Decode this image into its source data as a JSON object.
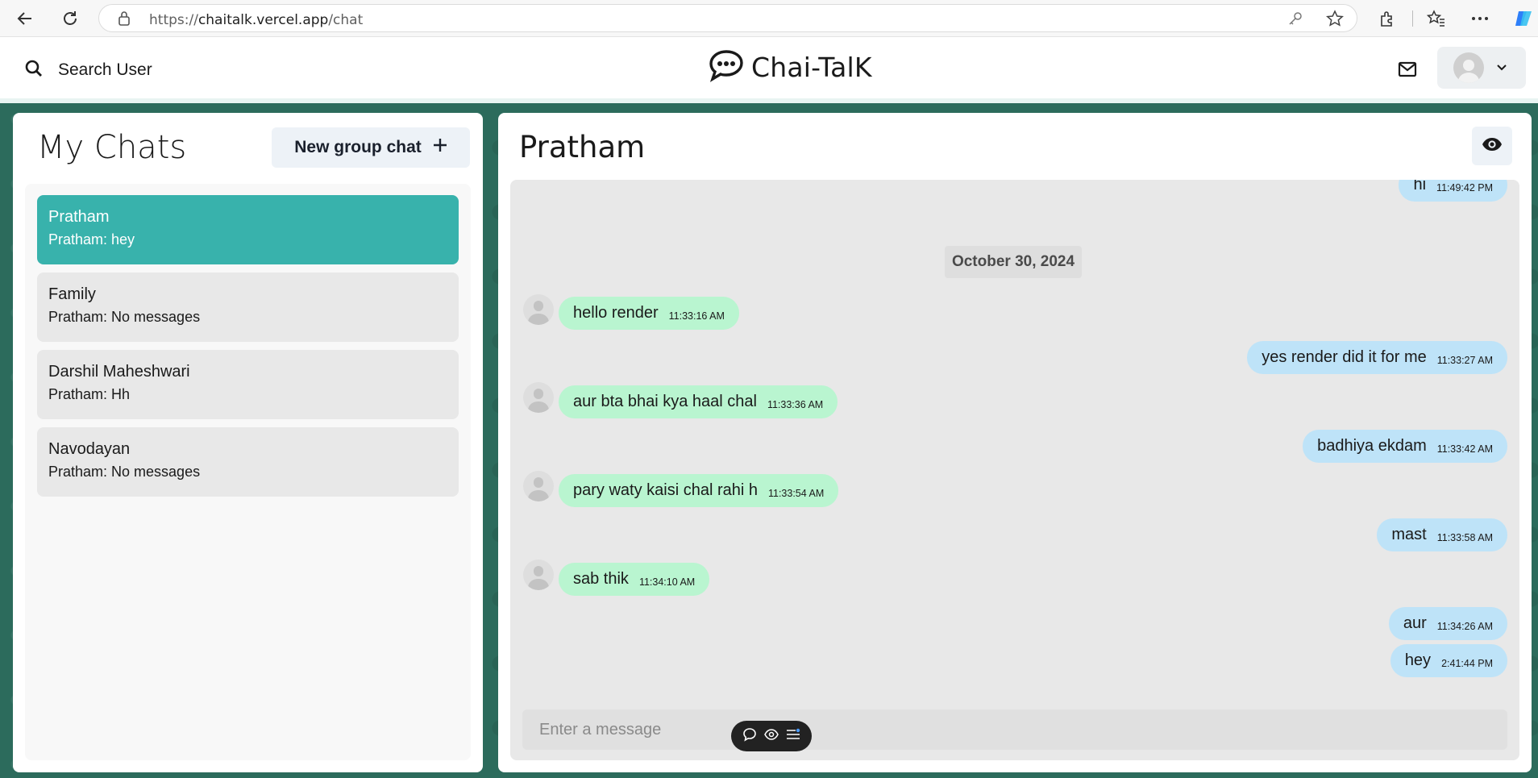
{
  "browser": {
    "url_prefix": "https://",
    "url_host": "chaitalk.vercel.app",
    "url_path": "/chat"
  },
  "header": {
    "search_label": "Search User",
    "brand": "Chai-TalK"
  },
  "sidebar": {
    "title": "My Chats",
    "new_group_label": "New group chat",
    "chats": [
      {
        "name": "Pratham",
        "preview": "Pratham: hey",
        "active": true
      },
      {
        "name": "Family",
        "preview": "Pratham: No messages",
        "active": false
      },
      {
        "name": "Darshil Maheshwari",
        "preview": "Pratham: Hh",
        "active": false
      },
      {
        "name": "Navodayan",
        "preview": "Pratham: No messages",
        "active": false
      }
    ]
  },
  "chat": {
    "title": "Pratham",
    "date_separator": "October 30, 2024",
    "messages": [
      {
        "text": "hi",
        "time": "11:49:42 PM",
        "direction": "out"
      },
      {
        "text": "hello render",
        "time": "11:33:16 AM",
        "direction": "in"
      },
      {
        "text": "yes render did it for me",
        "time": "11:33:27 AM",
        "direction": "out"
      },
      {
        "text": "aur bta bhai kya haal chal",
        "time": "11:33:36 AM",
        "direction": "in"
      },
      {
        "text": "badhiya ekdam",
        "time": "11:33:42 AM",
        "direction": "out"
      },
      {
        "text": "pary waty kaisi chal rahi h",
        "time": "11:33:54 AM",
        "direction": "in"
      },
      {
        "text": "mast",
        "time": "11:33:58 AM",
        "direction": "out"
      },
      {
        "text": "sab thik",
        "time": "11:34:10 AM",
        "direction": "in"
      },
      {
        "text": "aur",
        "time": "11:34:26 AM",
        "direction": "out"
      },
      {
        "text": "hey",
        "time": "2:41:44 PM",
        "direction": "out"
      }
    ],
    "input_placeholder": "Enter a message"
  },
  "colors": {
    "active_chat": "#38b2ac",
    "incoming_bubble": "#b9f5d0",
    "outgoing_bubble": "#bee3f8"
  }
}
